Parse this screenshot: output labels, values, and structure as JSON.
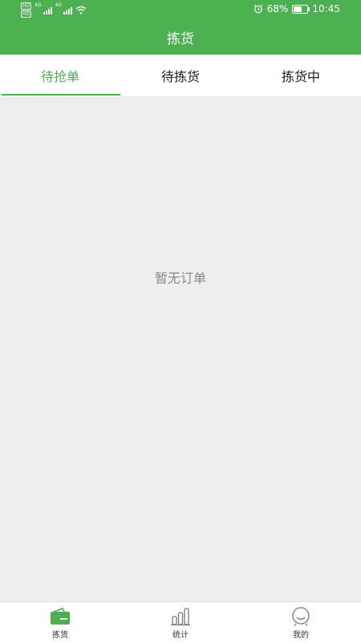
{
  "status_bar": {
    "hd1": "HD",
    "hd2": "HD",
    "net1": "4G",
    "net2": "4G",
    "battery_percent": "68%",
    "battery_level": 0.68,
    "time": "10:45"
  },
  "header": {
    "title": "拣货"
  },
  "tabs": [
    {
      "label": "待抢单",
      "active": true
    },
    {
      "label": "待拣货",
      "active": false
    },
    {
      "label": "拣货中",
      "active": false
    }
  ],
  "main": {
    "empty_message": "暂无订单"
  },
  "bottom_nav": {
    "items": [
      {
        "label": "拣货",
        "icon": "wallet-icon",
        "active": true
      },
      {
        "label": "统计",
        "icon": "bar-chart-icon",
        "active": false
      },
      {
        "label": "我的",
        "icon": "user-face-icon",
        "active": false
      }
    ]
  },
  "colors": {
    "accent": "#4caf50",
    "background": "#eeeeee",
    "muted_text": "#888888"
  }
}
